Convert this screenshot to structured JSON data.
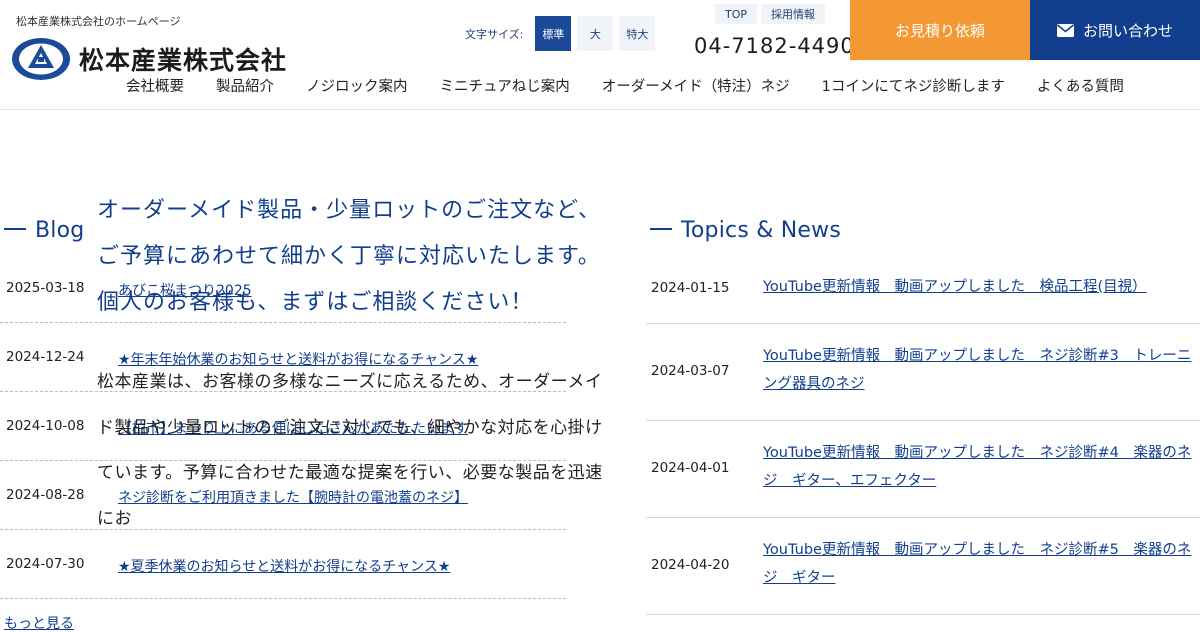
{
  "header": {
    "tagline": "松本産業株式会社のホームページ",
    "logo_text": "松本産業株式会社",
    "font_size_label": "文字サイズ:",
    "font_sizes": [
      "標準",
      "大",
      "特大"
    ],
    "top_links": [
      "TOP",
      "採用情報"
    ],
    "phone": "04-7182-4490",
    "estimate_label": "お見積り依頼",
    "contact_label": "お問い合わせ",
    "nav": [
      "会社概要",
      "製品紹介",
      "ノジロック案内",
      "ミニチュアねじ案内",
      "オーダーメイド（特注）ネジ",
      "1コインにてネジ診断します",
      "よくある質問"
    ]
  },
  "blog": {
    "title": "Blog",
    "items": [
      {
        "date": "2025-03-18",
        "title": "あびこ桜まつり2025"
      },
      {
        "date": "2024-12-24",
        "title": "★年末年始休業のお知らせと送料がお得になるチャンス★"
      },
      {
        "date": "2024-10-08",
        "title": "【柏市】まつり上にある伸ばしたさんがあたたたいます"
      },
      {
        "date": "2024-08-28",
        "title": "ネジ診断をご利用頂きました【腕時計の電池蓋のネジ】"
      },
      {
        "date": "2024-07-30",
        "title": "★夏季休業のお知らせと送料がお得になるチャンス★"
      }
    ],
    "more_label": "もっと見る"
  },
  "topics": {
    "title": "Topics & News",
    "items": [
      {
        "date": "2024-01-15",
        "title": "YouTube更新情報　動画アップしました　検品工程(目視）"
      },
      {
        "date": "2024-03-07",
        "title": "YouTube更新情報　動画アップしました　ネジ診断#3　トレーニング器具のネジ"
      },
      {
        "date": "2024-04-01",
        "title": "YouTube更新情報　動画アップしました　ネジ診断#4　楽器のネジ　ギター、エフェクター"
      },
      {
        "date": "2024-04-20",
        "title": "YouTube更新情報　動画アップしました　ネジ診断#5　楽器のネジ　ギター"
      }
    ]
  },
  "intro": {
    "heading": "オーダーメイド製品・少量ロットのご注文など、ご予算にあわせて細かく丁寧に対応いたします。個人のお客様も、まずはご相談ください！",
    "body": "松本産業は、お客様の多様なニーズに応えるため、オーダーメイド製品や少量ロットのご注文に対しても、細やかな対応を心掛けています。予算に合わせた最適な提案を行い、必要な製品を迅速にお"
  },
  "colors": {
    "brand_navy": "#123f8d",
    "accent_orange": "#f39833"
  }
}
